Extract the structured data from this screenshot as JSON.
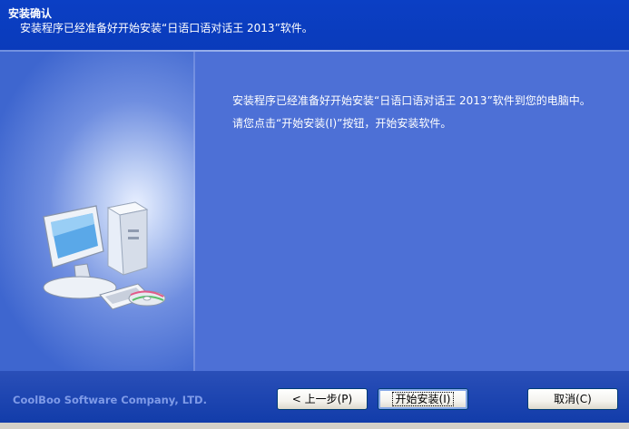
{
  "header": {
    "title": "安装确认",
    "subtitle": "安装程序已经准备好开始安装“日语口语对话王 2013”软件。"
  },
  "main": {
    "message_line1": "安装程序已经准备好开始安装“日语口语对话王 2013”软件到您的电脑中。",
    "message_line2": "请您点击“开始安装(I)”按钮，开始安装软件。"
  },
  "footer": {
    "company": "CoolBoo Software Company, LTD.",
    "back_label": "< 上一步(P)",
    "install_label": "开始安装(I)",
    "cancel_label": "取消(C)"
  },
  "icons": {
    "setup_art": "computer-with-cd-icon"
  },
  "colors": {
    "header_bg": "#0b3fc4",
    "panel_bg": "#4d70d6",
    "footer_bg": "#1a43b0",
    "company_text": "#7f9be8"
  }
}
